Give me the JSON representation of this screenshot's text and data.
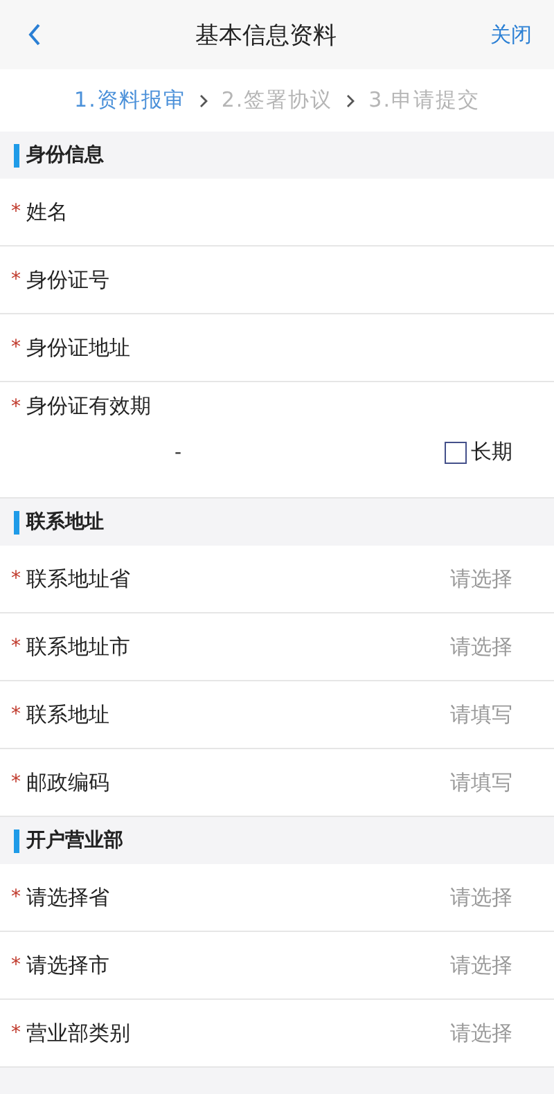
{
  "header": {
    "title": "基本信息资料",
    "close": "关闭"
  },
  "steps": [
    {
      "label": "1.资料报审",
      "selected": true
    },
    {
      "label": "2.签署协议",
      "selected": false
    },
    {
      "label": "3.申请提交",
      "selected": false
    }
  ],
  "sections": [
    {
      "title": "身份信息",
      "fields": [
        {
          "kind": "text",
          "required_mark": "*",
          "label": "姓名"
        },
        {
          "kind": "text",
          "required_mark": "*",
          "label": "身份证号"
        },
        {
          "kind": "text",
          "required_mark": "*",
          "label": "身份证地址"
        },
        {
          "kind": "daterange",
          "required_mark": "*",
          "label": "身份证有效期",
          "separator": "-",
          "checkbox": {
            "label": "长期",
            "checked": false
          }
        }
      ]
    },
    {
      "title": "联系地址",
      "fields": [
        {
          "kind": "select",
          "required_mark": "*",
          "label": "联系地址省",
          "placeholder": "请选择"
        },
        {
          "kind": "select",
          "required_mark": "*",
          "label": "联系地址市",
          "placeholder": "请选择"
        },
        {
          "kind": "input",
          "required_mark": "*",
          "label": "联系地址",
          "placeholder": "请填写"
        },
        {
          "kind": "input",
          "required_mark": "*",
          "label": "邮政编码",
          "placeholder": "请填写"
        }
      ]
    },
    {
      "title": "开户营业部",
      "fields": [
        {
          "kind": "select",
          "required_mark": "*",
          "label": "请选择省",
          "placeholder": "请选择"
        },
        {
          "kind": "select",
          "required_mark": "*",
          "label": "请选择市",
          "placeholder": "请选择"
        },
        {
          "kind": "select",
          "required_mark": "*",
          "label": "营业部类别",
          "placeholder": "请选择"
        }
      ]
    }
  ]
}
